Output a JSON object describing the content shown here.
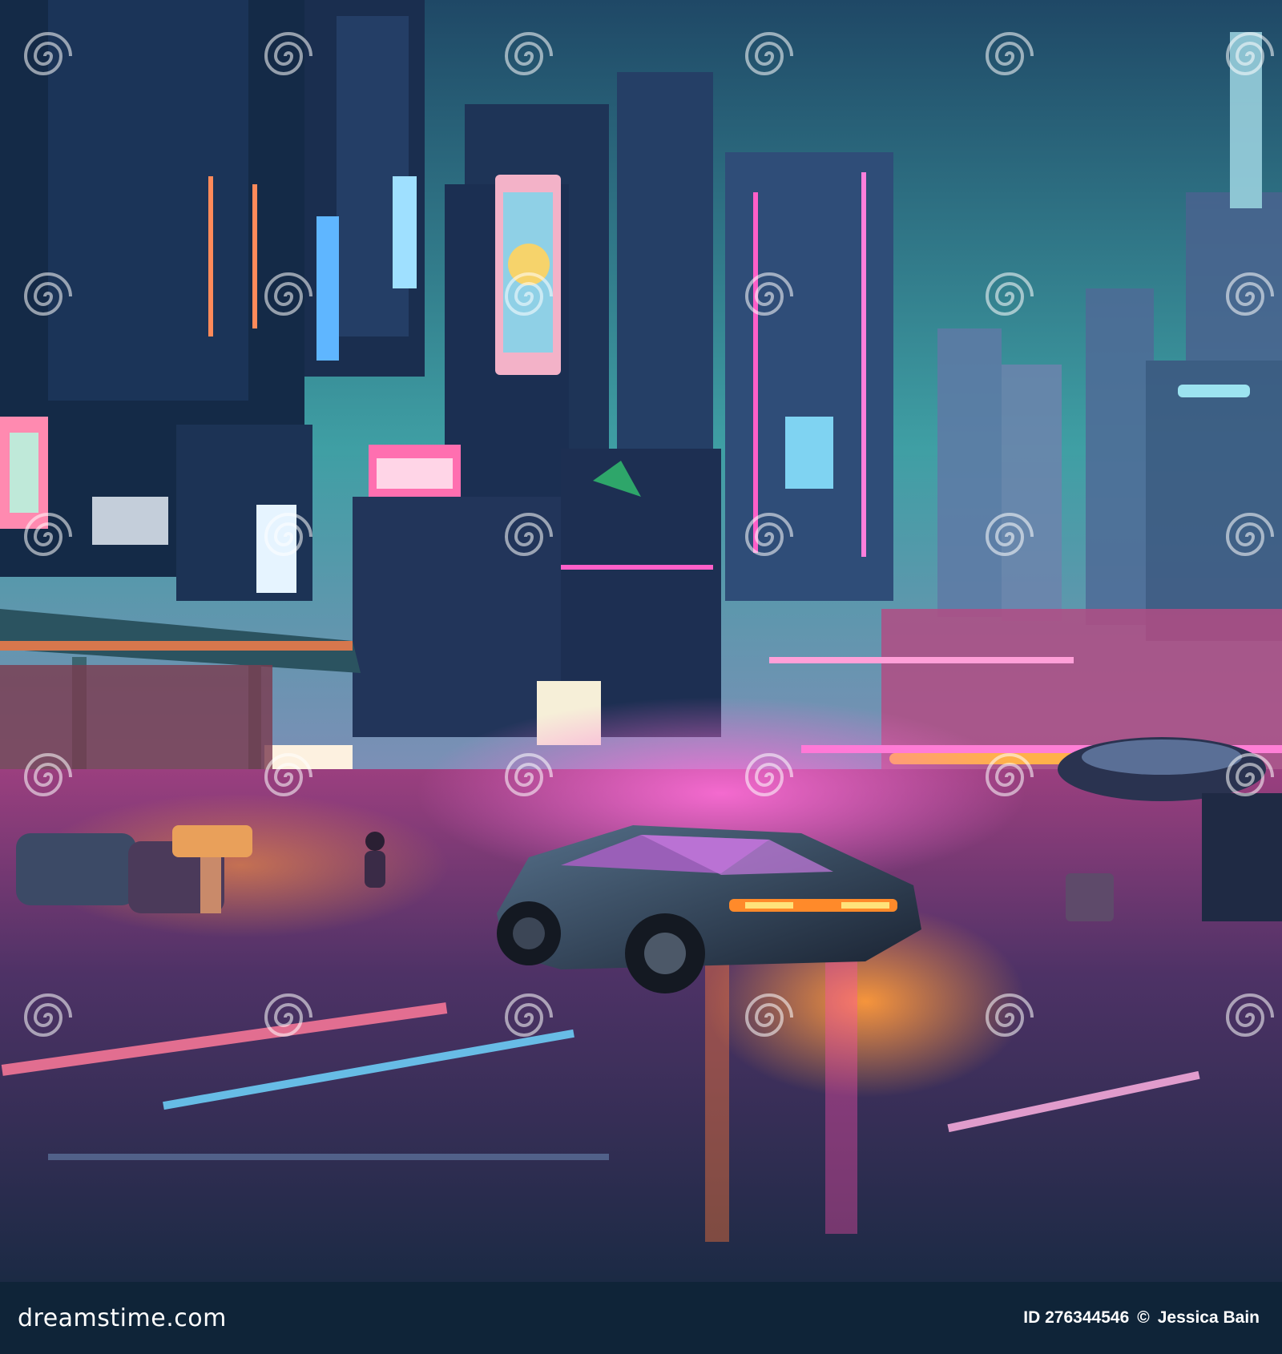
{
  "image": {
    "description_kind": "stock illustration",
    "watermark": {
      "brand": "dreamstime",
      "icon": "spiral-icon"
    }
  },
  "footer": {
    "logo_text": "dreamstime.com",
    "id_label": "ID 276344546",
    "separator": "©",
    "author": "Jessica Bain"
  },
  "palette": {
    "sky_top": "#1d3f5c",
    "sky_teal": "#3fb0a8",
    "neon_pink": "#ff5fc8",
    "neon_orange": "#ff8a3a",
    "footer_bg": "#0f2438"
  }
}
